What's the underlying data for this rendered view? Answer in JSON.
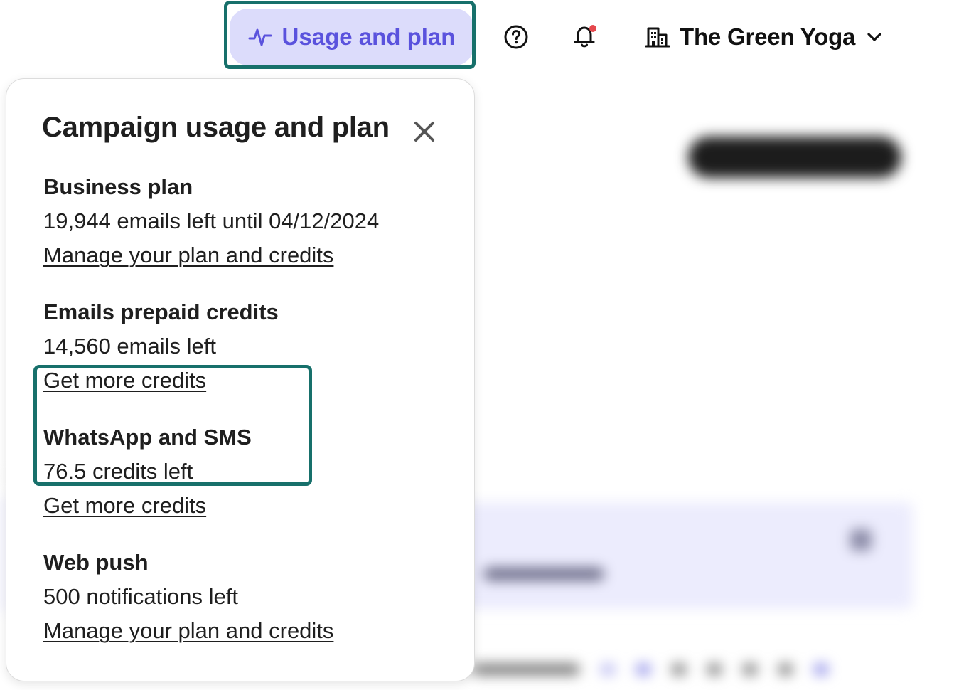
{
  "header": {
    "usage_button_label": "Usage and plan",
    "account_name": "The Green Yoga",
    "icons": {
      "usage": "activity-pulse-icon",
      "help": "help-circle-icon",
      "notifications": "bell-icon",
      "account": "building-icon",
      "account_menu": "chevron-down-icon"
    },
    "notification_dot_color": "#e5484d"
  },
  "popover": {
    "title": "Campaign usage and plan",
    "close_icon": "close-icon",
    "sections": [
      {
        "title": "Business plan",
        "detail": "19,944 emails left until 04/12/2024",
        "link": "Manage your plan and credits"
      },
      {
        "title": "Emails prepaid credits",
        "detail": "14,560 emails left",
        "link": "Get more credits"
      },
      {
        "title": "WhatsApp and SMS",
        "detail": "76.5 credits left",
        "link": "Get more credits"
      },
      {
        "title": "Web push",
        "detail": "500 notifications left",
        "link": "Manage your plan and credits"
      }
    ]
  },
  "colors": {
    "accent": "#5a52dd",
    "accent_bg": "#dcdcfb",
    "highlight_border": "#17706b",
    "text": "#1f1f1f"
  }
}
